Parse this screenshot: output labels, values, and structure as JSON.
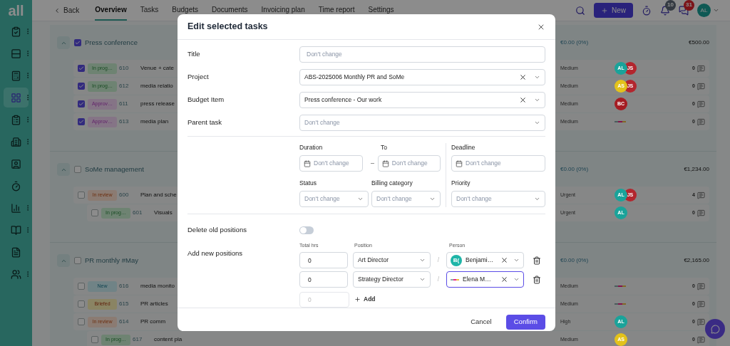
{
  "nav": {
    "logo": "all",
    "back": "Back",
    "tabs": [
      {
        "label": "Overview",
        "selected": true
      },
      {
        "label": "Tasks",
        "selected": false
      },
      {
        "label": "Budgets",
        "selected": false
      },
      {
        "label": "Documents",
        "selected": false
      },
      {
        "label": "Invoicing plan",
        "selected": false
      },
      {
        "label": "Time report",
        "selected": false
      },
      {
        "label": "Settings",
        "selected": false
      }
    ],
    "new_button": "New",
    "bell_badge": "10",
    "chat_badge": "31",
    "avatar": "AL"
  },
  "sidebar": {
    "items": [
      {
        "selected": false,
        "menu": true
      },
      {
        "selected": false,
        "menu": true
      },
      {
        "selected": false,
        "menu": true
      },
      {
        "selected": true,
        "menu": true
      },
      {
        "selected": false,
        "menu": true
      },
      {
        "selected": false,
        "menu": true
      },
      {
        "selected": false,
        "menu": false
      },
      {
        "selected": false,
        "menu": false
      },
      {
        "selected": false,
        "menu": true
      },
      {
        "selected": false,
        "menu": true
      },
      {
        "selected": false,
        "menu": false
      },
      {
        "selected": false,
        "menu": true
      }
    ]
  },
  "groups": [
    {
      "name": "Press conference",
      "checked": true,
      "spent": "€0.00 (0%)",
      "total": "€500.00",
      "tasks": [
        {
          "checked": true,
          "status": "In prog…",
          "kind": "progress",
          "number": "610",
          "title": "Venue + cate",
          "priority": "Medium",
          "assignees": [
            {
              "initials": "AL",
              "color": "#1aa39a"
            },
            {
              "initials": "JS",
              "color": "#b3262e"
            }
          ],
          "comments": "0"
        },
        {
          "checked": true,
          "status": "In prog…",
          "kind": "progress",
          "number": "612",
          "title": "media relatio",
          "priority": "Medium",
          "assignees": [
            {
              "initials": "AS",
              "color": "#e3c21b"
            },
            {
              "initials": "JS",
              "color": "#b3262e"
            }
          ],
          "comments": "0"
        },
        {
          "checked": true,
          "status": "Approv…",
          "kind": "approved",
          "number": "611",
          "title": "press release",
          "priority": "Medium",
          "assignees": [
            {
              "initials": "BC",
              "color": "#a51c22"
            }
          ],
          "comments": "0"
        },
        {
          "checked": true,
          "status": "Approv…",
          "kind": "approved",
          "number": "613",
          "title": "media plan",
          "priority": "Medium",
          "comments": "0"
        }
      ]
    },
    {
      "name": "SoMe management",
      "checked": false,
      "spent": "€0.00 (0%)",
      "total": "€1,234.00",
      "tasks": [
        {
          "checked": false,
          "status": "In review",
          "kind": "review",
          "number": "600",
          "title": "Plan and sche",
          "priority": "Urgent",
          "assignees": [
            {
              "initials": "AL",
              "color": "#1aa39a"
            },
            {
              "initials": "JS",
              "color": "#b3262e"
            }
          ],
          "comments": "4",
          "children": [
            {
              "checked": false,
              "status": "In prog…",
              "kind": "progress",
              "number": "601",
              "title": "Visuals",
              "priority": "Urgent",
              "assignees": [
                {
                  "initials": "AL",
                  "color": "#1aa39a"
                }
              ],
              "comments": "0"
            }
          ]
        }
      ]
    },
    {
      "name": "PR monthly #May",
      "checked": false,
      "spent": "€0.00 (0%)",
      "total": "€2,165.00",
      "tasks": [
        {
          "checked": false,
          "status": "New",
          "kind": "new",
          "number": "616",
          "title": "media monito",
          "priority": "Medium",
          "comments": "0"
        },
        {
          "checked": false,
          "status": "Briefed",
          "kind": "briefed",
          "number": "615",
          "title": "PR articles",
          "priority": "Medium",
          "comments": "0"
        },
        {
          "checked": false,
          "status": "In review",
          "kind": "review",
          "number": "614",
          "title": "PR comm",
          "priority": "High",
          "assignees": [
            {
              "initials": "AL",
              "color": "#1aa39a"
            }
          ],
          "comments": "0",
          "children": [
            {
              "checked": false,
              "status": "In prog…",
              "kind": "progress",
              "number": "617",
              "title": "content pla",
              "priority": "Medium",
              "assignees": [
                {
                  "initials": "AS",
                  "color": "#e3c21b"
                }
              ],
              "comments": "0"
            }
          ]
        }
      ]
    }
  ],
  "dialog": {
    "title": "Edit selected tasks",
    "fields": [
      {
        "label": "Title",
        "kind": "text",
        "placeholder": "Don't change"
      },
      {
        "label": "Project",
        "kind": "select",
        "value": "ABS-2025006 Monthly PR and SoMe",
        "clearable": true
      },
      {
        "label": "Budget Item",
        "kind": "select",
        "value": "Press conference - Our work",
        "clearable": true
      },
      {
        "label": "Parent task",
        "kind": "select",
        "placeholder": "Don't change",
        "clearable": false
      }
    ],
    "dates": [
      {
        "label": "Duration",
        "placeholder": "Don't change"
      },
      {
        "label": "To",
        "placeholder": "Don't change"
      },
      {
        "label": "Deadline",
        "placeholder": "Don't change"
      }
    ],
    "range_separator": "–",
    "selects": [
      {
        "label": "Status",
        "placeholder": "Don't change"
      },
      {
        "label": "Billing category",
        "placeholder": "Don't change"
      },
      {
        "label": "Priority",
        "placeholder": "Don't change"
      }
    ],
    "delete_old_positions": {
      "label": "Delete old positions",
      "on": false
    },
    "positions": {
      "label": "Add new positions",
      "columns": [
        "Total hrs",
        "Position",
        "Person"
      ],
      "rows": [
        {
          "hours": "0",
          "position": "Art Director",
          "separator": "/",
          "person": "Benjami…",
          "avatar": {
            "initials": "B(",
            "color": "#1fb5a8"
          },
          "focused": false
        },
        {
          "hours": "0",
          "position": "Strategy Director",
          "separator": "/",
          "person": "Elena M…",
          "focused": true
        }
      ],
      "new_hours_placeholder": "0",
      "add": "Add"
    },
    "cancel": "Cancel",
    "confirm": "Confirm"
  }
}
